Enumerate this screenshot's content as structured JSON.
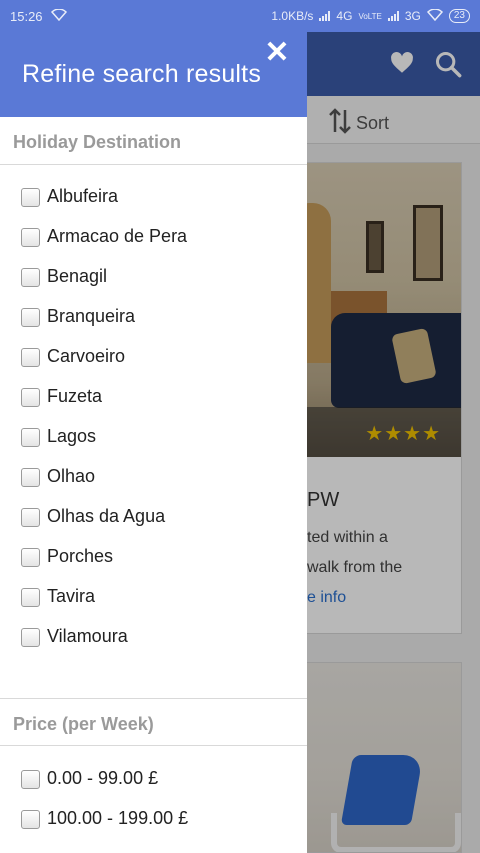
{
  "status_bar": {
    "time": "15:26",
    "speed": "1.0KB/s",
    "network1": "4G",
    "volte": "VoLTE",
    "network2": "3G",
    "battery": "23"
  },
  "background": {
    "sort_label": "Sort",
    "card1": {
      "title_fragment": "PW",
      "desc_line1": "ted within a",
      "desc_line2": "walk from the",
      "more_link": "e info",
      "stars": "★★★★"
    }
  },
  "drawer": {
    "title": "Refine search results",
    "close_symbol": "✕",
    "sections": [
      {
        "heading": "Holiday Destination",
        "options": [
          "Albufeira",
          "Armacao de Pera",
          "Benagil",
          "Branqueira",
          "Carvoeiro",
          "Fuzeta",
          "Lagos",
          "Olhao",
          "Olhas da Agua",
          "Porches",
          "Tavira",
          "Vilamoura"
        ]
      },
      {
        "heading": "Price (per Week)",
        "options": [
          "0.00 - 99.00 £",
          "100.00 - 199.00 £"
        ]
      }
    ]
  },
  "colors": {
    "drawer_header": "#5a79d6",
    "app_header": "#3b5aa8",
    "star": "#f2c200",
    "link": "#2a6fcf"
  }
}
